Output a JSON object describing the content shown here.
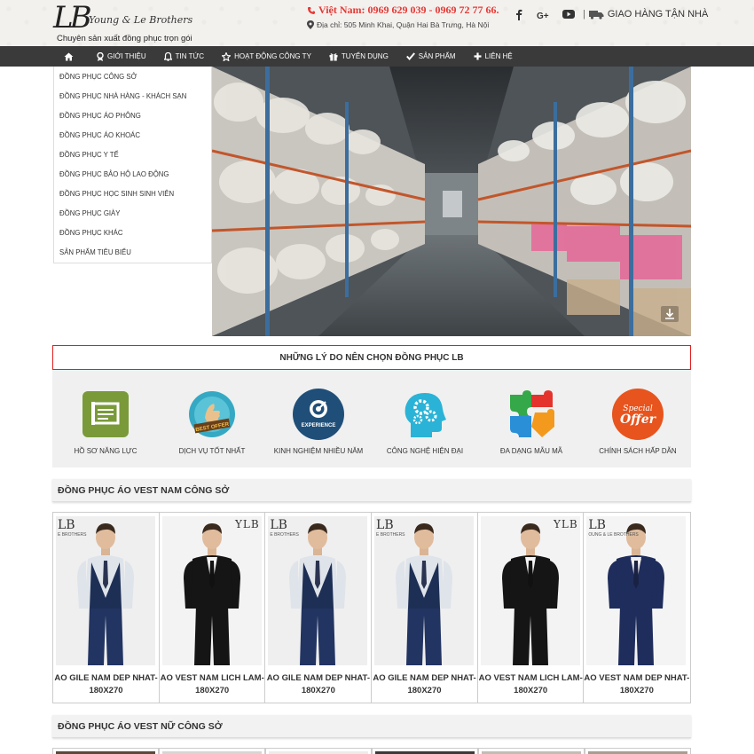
{
  "header": {
    "logo_mark": "LB",
    "logo_script": "Young & Le Brothers",
    "logo_tagline": "Chuyên sản xuất đồng phục trọn gói",
    "phone": "Việt Nam: 0969 629 039 - 0969 72 77 66.",
    "address": "Địa chỉ: 505 Minh Khai, Quận Hai Bà Trưng, Hà Nội",
    "social": [
      {
        "icon": "facebook-icon",
        "label": "f"
      },
      {
        "icon": "google-plus-icon",
        "label": "G+"
      },
      {
        "icon": "youtube-icon",
        "label": "▶"
      }
    ],
    "delivery": "GIAO HÀNG TẬN NHÀ",
    "delivery_sep": "|"
  },
  "nav": {
    "items": [
      {
        "label": "GIỚI THIỆU",
        "icon": "award-icon"
      },
      {
        "label": "TIN TỨC",
        "icon": "bell-icon"
      },
      {
        "label": "HOẠT ĐỘNG CÔNG TY",
        "icon": "star-icon"
      },
      {
        "label": "TUYỂN DỤNG",
        "icon": "gift-icon"
      },
      {
        "label": "SẢN PHẨM",
        "icon": "check-icon"
      },
      {
        "label": "LIÊN HỆ",
        "icon": "plus-icon"
      }
    ]
  },
  "sidebar": {
    "items": [
      "ĐỒNG PHỤC CÔNG SỞ",
      "ĐỒNG PHỤC NHÀ HÀNG - KHÁCH SẠN",
      "ĐỒNG PHỤC ÁO PHÔNG",
      "ĐỒNG PHỤC ÁO KHOÁC",
      "ĐỒNG PHỤC Y TẾ",
      "ĐỒNG PHỤC BẢO HỘ LAO ĐỘNG",
      "ĐỒNG PHỤC HỌC SINH SINH VIÊN",
      "ĐỒNG PHỤC GIÀY",
      "ĐỒNG PHỤC KHÁC",
      "SẢN PHẨM TIÊU BIỂU"
    ]
  },
  "reasons": {
    "title": "NHỮNG LÝ DO NÊN CHỌN ĐỒNG PHỤC LB",
    "items": [
      {
        "label": "HỒ SƠ NĂNG LỰC",
        "icon": "profile-doc-icon"
      },
      {
        "label": "DỊCH VỤ TỐT NHẤT",
        "icon": "best-offer-badge-icon",
        "badge_text": "BEST OFFER"
      },
      {
        "label": "KINH NGHIỆM NHIỀU NĂM",
        "icon": "experience-icon",
        "badge_text": "EXPERIENCE"
      },
      {
        "label": "CÔNG NGHỆ HIỆN ĐẠI",
        "icon": "head-gears-icon"
      },
      {
        "label": "ĐA DẠNG MẪU MÃ",
        "icon": "puzzle-icon"
      },
      {
        "label": "CHÍNH SÁCH HẤP DẪN",
        "icon": "special-offer-icon",
        "badge_text_1": "Special",
        "badge_text_2": "Offer"
      }
    ]
  },
  "section_vest_nam": {
    "title": "ĐỒNG PHỤC ÁO VEST NAM CÔNG SỞ",
    "products": [
      {
        "name": "AO GILE NAM DEP NHAT-180X270",
        "style": "gile",
        "brand": "LB",
        "brand_sub": "E BROTHERS"
      },
      {
        "name": "AO VEST NAM LICH LAM-180X270",
        "style": "black",
        "brand_r": "YLB"
      },
      {
        "name": "AO GILE NAM DEP NHAT-180X270",
        "style": "gile",
        "brand": "LB",
        "brand_sub": "E BROTHERS"
      },
      {
        "name": "AO GILE NAM DEP NHAT-180X270",
        "style": "gile",
        "brand": "LB",
        "brand_sub": "E BROTHERS"
      },
      {
        "name": "AO VEST NAM LICH LAM-180X270",
        "style": "black",
        "brand_r": "YLB"
      },
      {
        "name": "AO VEST NAM DEP NHAT-180X270",
        "style": "navy",
        "brand": "LB",
        "brand_sub": "OUNG & LE BROTHERS"
      }
    ]
  },
  "section_vest_nu": {
    "title": "ĐỒNG PHỤC ÁO VEST NỮ CÔNG SỞ"
  },
  "colors": {
    "nav_bg": "#3a3a3a",
    "accent_red": "#e53935",
    "reasons_bg": "#f0f0f0"
  }
}
